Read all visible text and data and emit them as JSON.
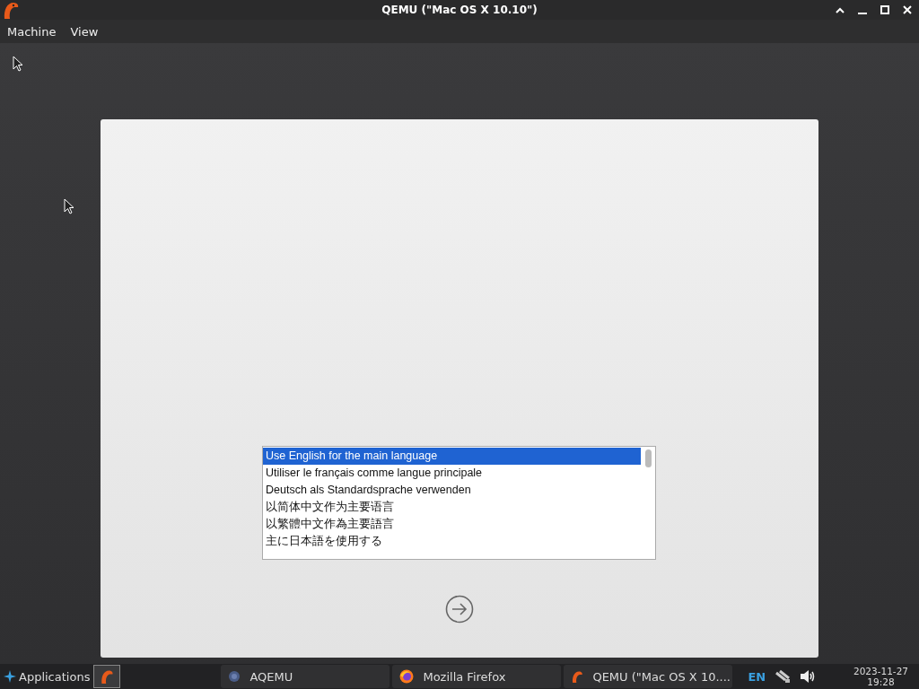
{
  "window": {
    "title": "QEMU (\"Mac OS X 10.10\")"
  },
  "menu": [
    {
      "label": "Machine"
    },
    {
      "label": "View"
    }
  ],
  "installer": {
    "languages": [
      {
        "label": "Use English for the main language",
        "selected": true
      },
      {
        "label": "Utiliser le français comme langue principale",
        "selected": false
      },
      {
        "label": "Deutsch als Standardsprache verwenden",
        "selected": false
      },
      {
        "label": "以简体中文作为主要语言",
        "selected": false
      },
      {
        "label": "以繁體中文作為主要語言",
        "selected": false
      },
      {
        "label": "主に日本語を使用する",
        "selected": false
      }
    ]
  },
  "taskbar": {
    "start": "Applications",
    "tasks": [
      {
        "label": "AQEMU",
        "kind": "aqemu"
      },
      {
        "label": "Mozilla Firefox",
        "kind": "firefox"
      },
      {
        "label": "QEMU (\"Mac OS X 10....",
        "kind": "qemu"
      }
    ],
    "keyboard": "EN",
    "date": "2023-11-27",
    "time": "19:28"
  }
}
